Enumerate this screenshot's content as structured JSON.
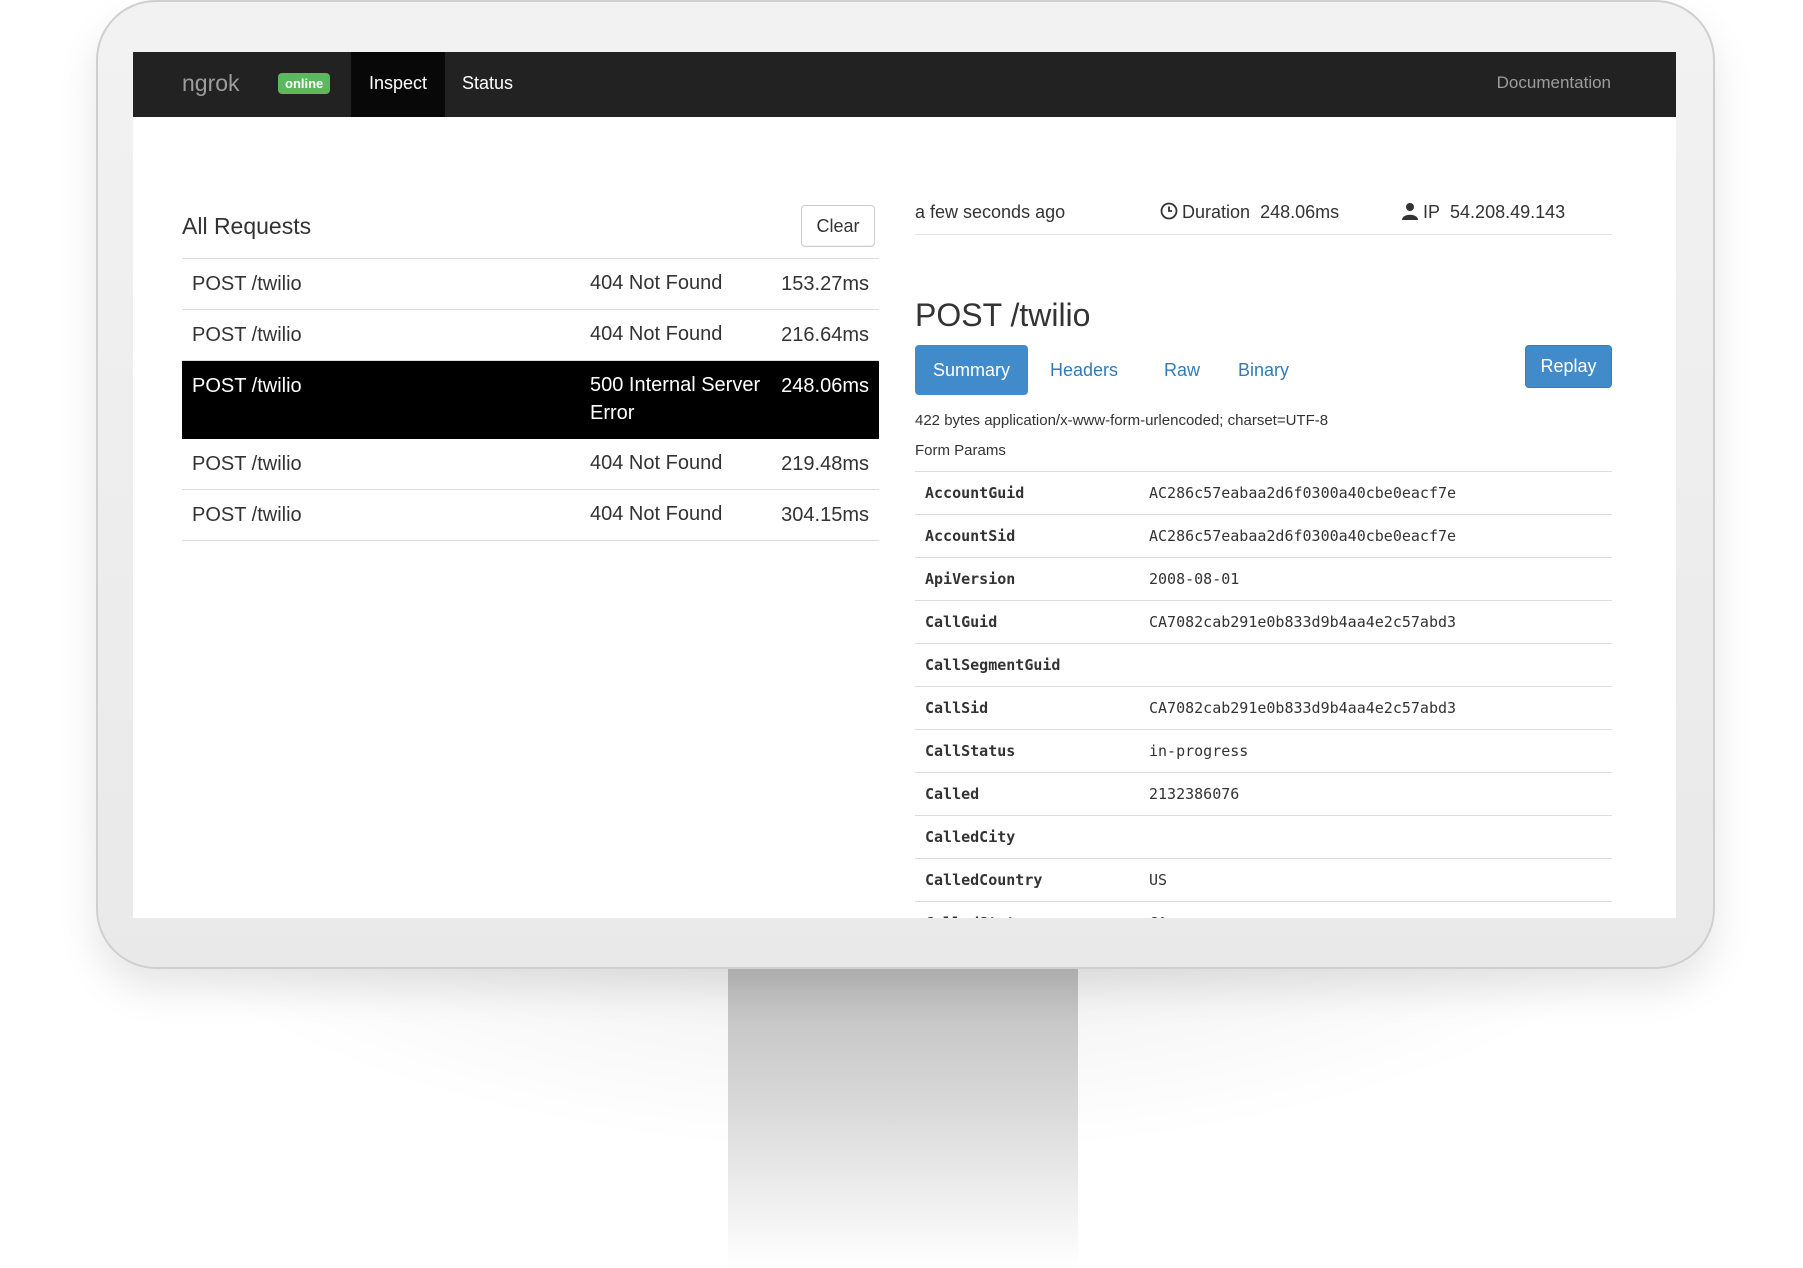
{
  "navbar": {
    "brand": "ngrok",
    "badge": "online",
    "tabs": [
      {
        "label": "Inspect",
        "active": true
      },
      {
        "label": "Status",
        "active": false
      }
    ],
    "documentation": "Documentation"
  },
  "requests": {
    "title": "All Requests",
    "clear_label": "Clear",
    "rows": [
      {
        "path": "POST /twilio",
        "status": "404 Not Found",
        "duration": "153.27ms",
        "selected": false
      },
      {
        "path": "POST /twilio",
        "status": "404 Not Found",
        "duration": "216.64ms",
        "selected": false
      },
      {
        "path": "POST /twilio",
        "status": "500 Internal Server Error",
        "duration": "248.06ms",
        "selected": true
      },
      {
        "path": "POST /twilio",
        "status": "404 Not Found",
        "duration": "219.48ms",
        "selected": false
      },
      {
        "path": "POST /twilio",
        "status": "404 Not Found",
        "duration": "304.15ms",
        "selected": false
      }
    ]
  },
  "detail": {
    "time_ago": "a few seconds ago",
    "duration_label": "Duration",
    "duration": "248.06ms",
    "ip_label": "IP",
    "ip": "54.208.49.143",
    "title": "POST /twilio",
    "tabs": [
      {
        "label": "Summary",
        "active": true
      },
      {
        "label": "Headers",
        "active": false
      },
      {
        "label": "Raw",
        "active": false
      },
      {
        "label": "Binary",
        "active": false
      }
    ],
    "replay_label": "Replay",
    "content_type": "422 bytes application/x-www-form-urlencoded; charset=UTF-8",
    "form_params_label": "Form Params",
    "params": [
      {
        "key": "AccountGuid",
        "value": "AC286c57eabaa2d6f0300a40cbe0eacf7e"
      },
      {
        "key": "AccountSid",
        "value": "AC286c57eabaa2d6f0300a40cbe0eacf7e"
      },
      {
        "key": "ApiVersion",
        "value": "2008-08-01"
      },
      {
        "key": "CallGuid",
        "value": "CA7082cab291e0b833d9b4aa4e2c57abd3"
      },
      {
        "key": "CallSegmentGuid",
        "value": ""
      },
      {
        "key": "CallSid",
        "value": "CA7082cab291e0b833d9b4aa4e2c57abd3"
      },
      {
        "key": "CallStatus",
        "value": "in-progress"
      },
      {
        "key": "Called",
        "value": "2132386076"
      },
      {
        "key": "CalledCity",
        "value": ""
      },
      {
        "key": "CalledCountry",
        "value": "US"
      },
      {
        "key": "CalledState",
        "value": "CA"
      }
    ]
  },
  "colors": {
    "navbar": "#222222",
    "online": "#5cb85c",
    "primary": "#428bca",
    "link": "#337ab7",
    "selected_row": "#000000"
  },
  "icons": {
    "duration": "clock-icon",
    "ip": "user-icon"
  }
}
